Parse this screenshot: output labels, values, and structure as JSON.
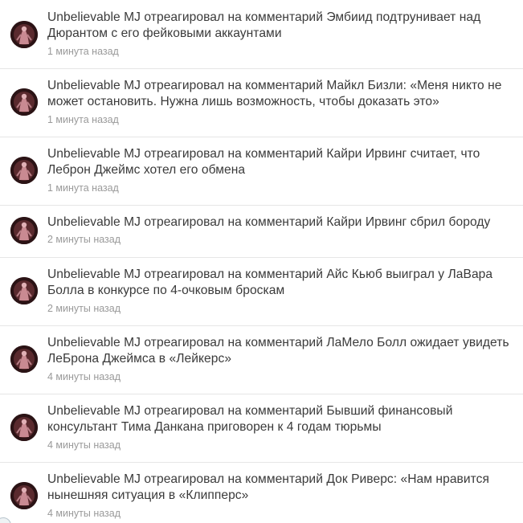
{
  "feed": {
    "items": [
      {
        "text": "Unbelievable MJ отреагировал на комментарий Эмбиид подтрунивает над Дюрантом с его фейковыми аккаунтами",
        "time": "1 минута назад",
        "avatar_icon": "user-avatar-icon"
      },
      {
        "text": "Unbelievable MJ отреагировал на комментарий Майкл Бизли: «Меня никто не может остановить. Нужна лишь возможность, чтобы доказать это»",
        "time": "1 минута назад",
        "avatar_icon": "user-avatar-icon"
      },
      {
        "text": "Unbelievable MJ отреагировал на комментарий Кайри Ирвинг считает, что Леброн Джеймс хотел его обмена",
        "time": "1 минута назад",
        "avatar_icon": "user-avatar-icon"
      },
      {
        "text": "Unbelievable MJ отреагировал на комментарий Кайри Ирвинг сбрил бороду",
        "time": "2 минуты назад",
        "avatar_icon": "user-avatar-icon"
      },
      {
        "text": "Unbelievable MJ отреагировал на комментарий Айс Кьюб выиграл у ЛаВара Болла в конкурсе по 4-очковым броскам",
        "time": "2 минуты назад",
        "avatar_icon": "user-avatar-icon"
      },
      {
        "text": "Unbelievable MJ отреагировал на комментарий ЛаМело Болл ожидает увидеть ЛеБрона Джеймса в «Лейкерс»",
        "time": "4 минуты назад",
        "avatar_icon": "user-avatar-icon"
      },
      {
        "text": "Unbelievable MJ отреагировал на комментарий Бывший финансовый консультант Тима Данкана приговорен к 4 годам тюрьмы",
        "time": "4 минуты назад",
        "avatar_icon": "user-avatar-icon"
      },
      {
        "text": "Unbelievable MJ отреагировал на комментарий Док Риверс: «Нам нравится нынешняя ситуация в «Клипперс»",
        "time": "4 минуты назад",
        "avatar_icon": "user-avatar-icon"
      }
    ]
  },
  "colors": {
    "text": "#3a3a3a",
    "time": "#9a9a9a",
    "divider": "#e6e6e6",
    "background": "#ffffff"
  }
}
